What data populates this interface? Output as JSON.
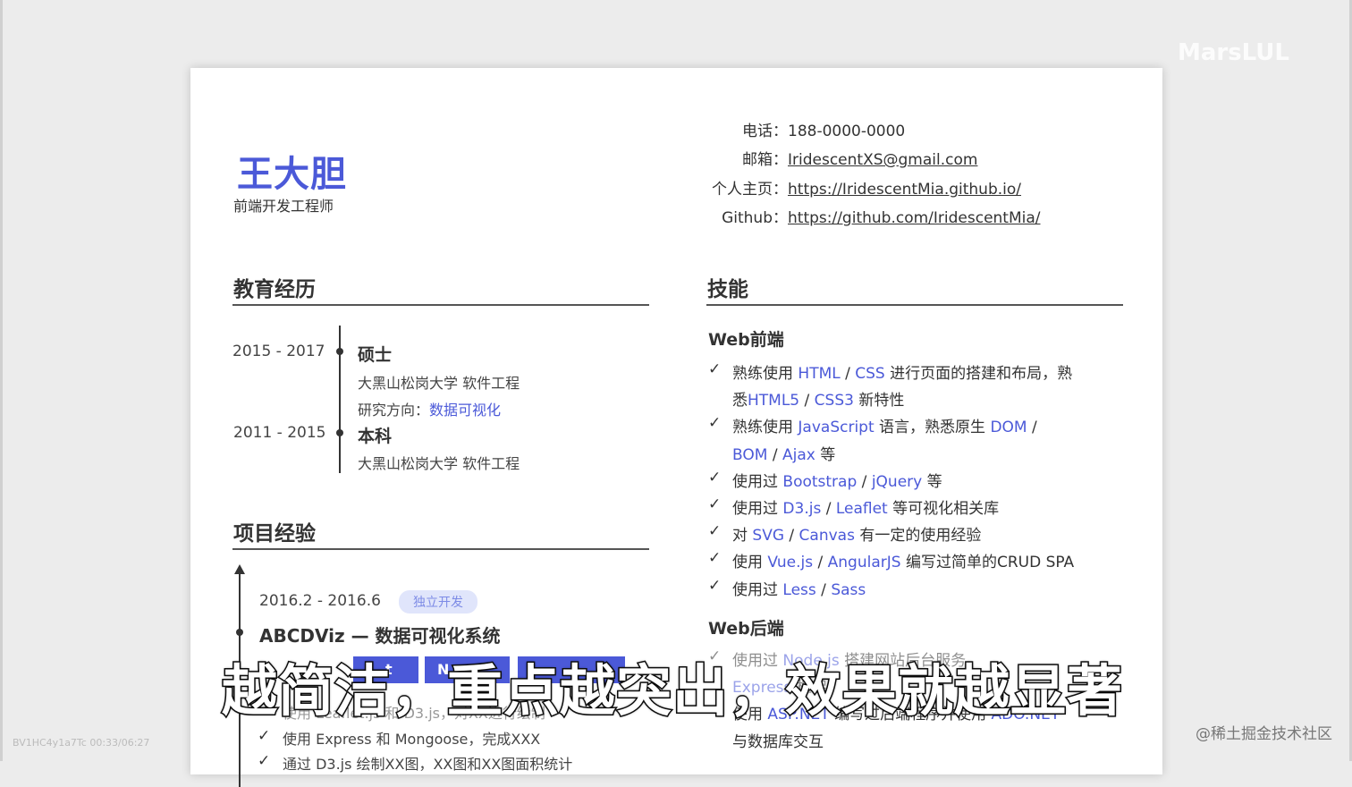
{
  "resume": {
    "name": "王大胆",
    "role": "前端开发工程师",
    "contacts": [
      {
        "label": "电话：",
        "value": "188-0000-0000"
      },
      {
        "label": "邮箱：",
        "value": "IridescentXS@gmail.com"
      },
      {
        "label": "个人主页：",
        "value": "https://IridescentMia.github.io/"
      },
      {
        "label": "Github：",
        "value": "https://github.com/IridescentMia/"
      }
    ],
    "education": {
      "title": "教育经历",
      "items": [
        {
          "years": "2015 - 2017",
          "degree": "硕士",
          "school": "大黑山松岗大学  软件工程",
          "research_label": "研究方向：",
          "research": "数据可视化"
        },
        {
          "years": "2011 - 2015",
          "degree": "本科",
          "school": "大黑山松岗大学  软件工程"
        }
      ]
    },
    "projects": {
      "title": "项目经验",
      "items": [
        {
          "dates": "2016.2 - 2016.6",
          "tag": "独立开发",
          "name": "ABCDViz — 数据可视化系统",
          "chips": [
            "t",
            "N"
          ],
          "bullets": [
            "使用 Leaflet.js 和 D3.js，对XX进行绘制",
            "使用 Express 和 Mongoose，完成XXX",
            "通过 D3.js 绘制XX图，XX图和XX图面积统计"
          ]
        }
      ]
    },
    "skills": {
      "title": "技能",
      "frontend": {
        "title": "Web前端",
        "items": [
          {
            "parts": [
              [
                "熟练使用 ",
                ""
              ],
              [
                "HTML",
                "kw"
              ],
              [
                " / ",
                ""
              ],
              [
                "CSS",
                "kw"
              ],
              [
                " 进行页面的搭建和布局，熟",
                ""
              ]
            ]
          },
          {
            "parts": [
              [
                "悉",
                ""
              ],
              [
                "HTML5",
                "kw"
              ],
              [
                " / ",
                ""
              ],
              [
                "CSS3",
                "kw"
              ],
              [
                " 新特性",
                ""
              ]
            ],
            "continuation": true
          },
          {
            "parts": [
              [
                "熟练使用 ",
                ""
              ],
              [
                "JavaScript",
                "kw"
              ],
              [
                " 语言，熟悉原生 ",
                ""
              ],
              [
                "DOM",
                "kw"
              ],
              [
                " /",
                ""
              ]
            ]
          },
          {
            "parts": [
              [
                "BOM",
                "kw"
              ],
              [
                " / ",
                ""
              ],
              [
                "Ajax",
                "kw"
              ],
              [
                " 等",
                ""
              ]
            ],
            "continuation": true
          },
          {
            "parts": [
              [
                "使用过 ",
                ""
              ],
              [
                "Bootstrap",
                "kw"
              ],
              [
                " / ",
                ""
              ],
              [
                "jQuery",
                "kw"
              ],
              [
                " 等",
                ""
              ]
            ]
          },
          {
            "parts": [
              [
                "使用过 ",
                ""
              ],
              [
                "D3.js",
                "kw"
              ],
              [
                " / ",
                ""
              ],
              [
                "Leaflet",
                "kw"
              ],
              [
                " 等可视化相关库",
                ""
              ]
            ]
          },
          {
            "parts": [
              [
                "对 ",
                ""
              ],
              [
                "SVG",
                "kw"
              ],
              [
                " / ",
                ""
              ],
              [
                "Canvas",
                "kw"
              ],
              [
                " 有一定的使用经验",
                ""
              ]
            ]
          },
          {
            "parts": [
              [
                "使用 ",
                ""
              ],
              [
                "Vue.js",
                "kw"
              ],
              [
                " / ",
                ""
              ],
              [
                "AngularJS",
                "kw"
              ],
              [
                " 编写过简单的CRUD SPA",
                ""
              ]
            ]
          },
          {
            "parts": [
              [
                "使用过 ",
                ""
              ],
              [
                "Less",
                "kw"
              ],
              [
                " / ",
                ""
              ],
              [
                "Sass",
                "kw"
              ]
            ]
          }
        ]
      },
      "backend": {
        "title": "Web后端",
        "items": [
          {
            "parts": [
              [
                "使用过 ",
                ""
              ],
              [
                "Node.js",
                "kw"
              ],
              [
                " 搭建网站后台服务",
                ""
              ]
            ]
          },
          {
            "parts": [
              [
                "Express",
                "kw"
              ],
              [
                " 框架",
                ""
              ]
            ],
            "continuation": true
          },
          {
            "parts": [
              [
                "使用 ",
                ""
              ],
              [
                "ASP.NET",
                "kw"
              ],
              [
                " 编写过后端程序并使用 ",
                ""
              ],
              [
                "ADO.NET",
                "kw"
              ]
            ]
          },
          {
            "parts": [
              [
                "与数据库交互",
                ""
              ]
            ],
            "continuation": true
          }
        ]
      }
    }
  },
  "overlay": {
    "subtitle": "越简洁，重点越突出，效果就越显著",
    "brand": "MarsLUL",
    "community": "@稀土掘金技术社区",
    "video_id": "BV1HC4y1a7Tc 00:33/06:27"
  },
  "colors": {
    "accent": "#4b59d8",
    "tag_bg": "#e0e5fb"
  }
}
